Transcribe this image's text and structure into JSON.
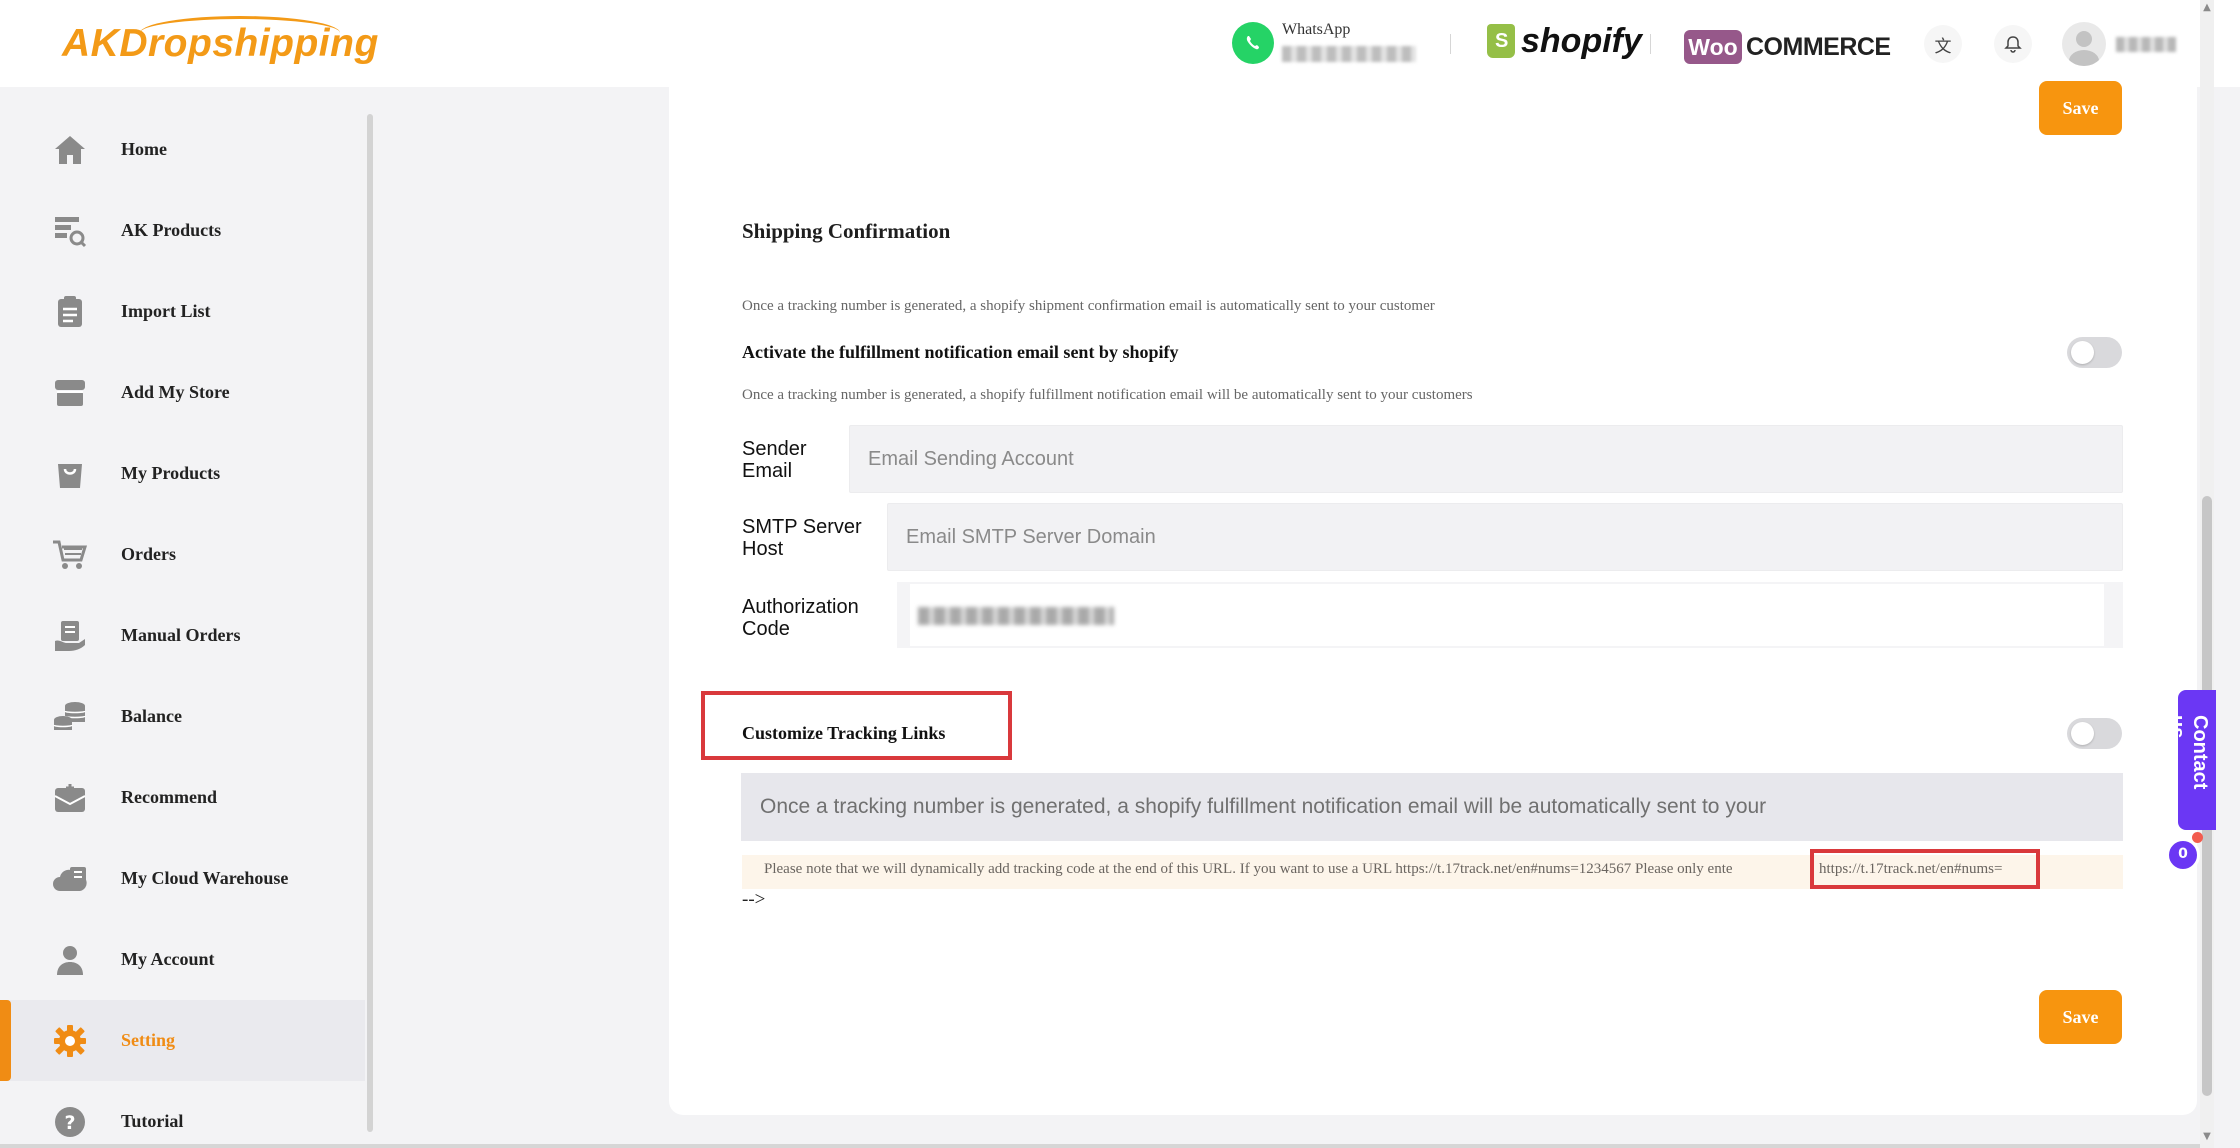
{
  "header": {
    "brand": "AKDropshipping",
    "whatsapp_label": "WhatsApp",
    "shopify_label": "shopify",
    "woo_badge": "Woo",
    "woo_label": "COMMERCE"
  },
  "sidebar": {
    "items": [
      {
        "label": "Home",
        "icon": "home-icon"
      },
      {
        "label": "AK Products",
        "icon": "product-search-icon"
      },
      {
        "label": "Import List",
        "icon": "clipboard-list-icon"
      },
      {
        "label": "Add My Store",
        "icon": "store-icon"
      },
      {
        "label": "My Products",
        "icon": "shopping-bag-icon"
      },
      {
        "label": "Orders",
        "icon": "cart-icon"
      },
      {
        "label": "Manual Orders",
        "icon": "manual-order-icon"
      },
      {
        "label": "Balance",
        "icon": "coins-icon"
      },
      {
        "label": "Recommend",
        "icon": "recommend-icon"
      },
      {
        "label": "My Cloud Warehouse",
        "icon": "warehouse-icon"
      },
      {
        "label": "My Account",
        "icon": "user-icon"
      },
      {
        "label": "Setting",
        "icon": "gear-icon",
        "active": true
      },
      {
        "label": "Tutorial",
        "icon": "help-icon"
      }
    ]
  },
  "main": {
    "save_label": "Save",
    "shipping_title": "Shipping Confirmation",
    "shipping_note": "Once a tracking number is generated, a shopify shipment confirmation email is automatically sent to your customer",
    "activate_label": "Activate the fulfillment notification email sent by shopify",
    "activate_note": "Once a tracking number is generated, a shopify fulfillment notification email will be automatically sent to your customers",
    "sender_label": "Sender Email",
    "sender_placeholder": "Email Sending Account",
    "smtp_label": "SMTP Server Host",
    "smtp_placeholder": "Email SMTP Server Domain",
    "auth_label": "Authorization Code",
    "custom_links_label": "Customize Tracking Links",
    "tracking_placeholder": "Once a tracking number is generated, a shopify fulfillment notification email will be automatically sent to your",
    "hint_text": "Please note that we will dynamically add tracking code at the end of this URL. If you want to use a URL https://t.17track.net/en#nums=1234567 Please only ente",
    "hint_url": "https://t.17track.net/en#nums=",
    "arrow_text": "-->"
  },
  "contact": {
    "label": "Contact us",
    "badge": "0"
  },
  "colors": {
    "accent": "#f7950f",
    "highlight": "#d9393c",
    "contact": "#6b37f4"
  }
}
